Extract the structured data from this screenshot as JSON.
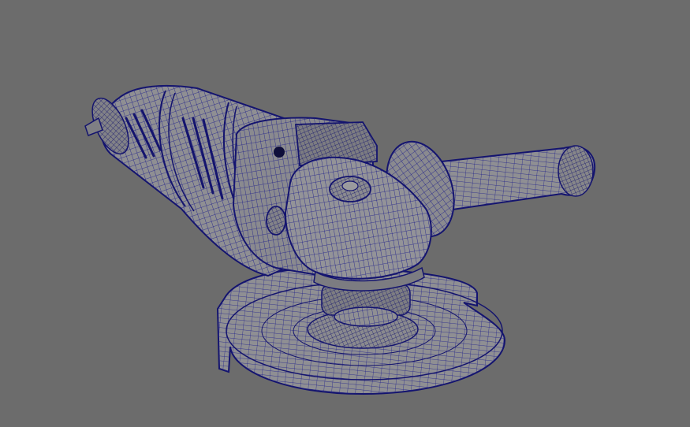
{
  "viewport": {
    "background": "#6c6c6c",
    "subject": "angle-grinder-wireframe",
    "shading": "wireframe-on-shaded",
    "colors": {
      "surface": "#8f8f93",
      "surface_light": "#a4a4a8",
      "surface_dark": "#77777c",
      "wire": "#1c1c8a",
      "wire_dense": "#14146e"
    }
  }
}
